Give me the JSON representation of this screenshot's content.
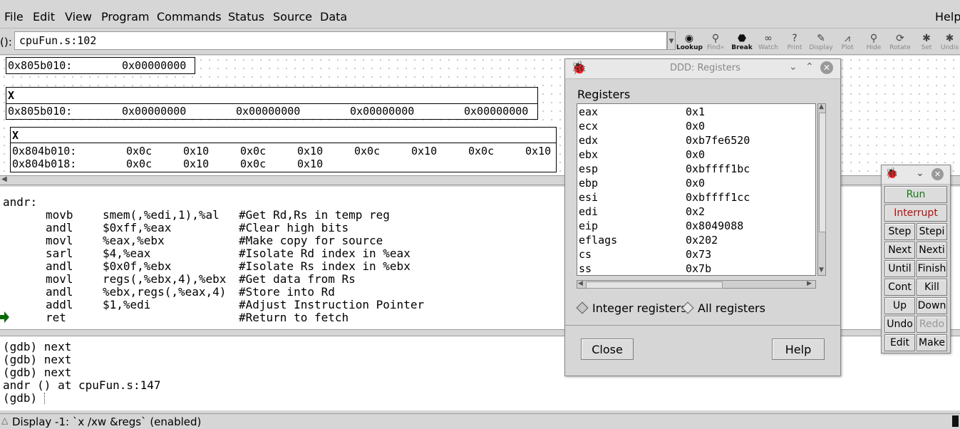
{
  "menu": {
    "items": [
      "File",
      "Edit",
      "View",
      "Program",
      "Commands",
      "Status",
      "Source",
      "Data"
    ],
    "help": "Help"
  },
  "argbar": {
    "label": "():",
    "value": "cpuFun.s:102"
  },
  "toolbar": [
    {
      "icon": "lookup-icon",
      "label": "Lookup",
      "enabled": true
    },
    {
      "icon": "find-icon",
      "label": "Find»",
      "enabled": false
    },
    {
      "icon": "break-icon",
      "label": "Break",
      "enabled": true
    },
    {
      "icon": "watch-icon",
      "label": "Watch",
      "enabled": false
    },
    {
      "icon": "print-icon",
      "label": "Print",
      "enabled": false
    },
    {
      "icon": "display-icon",
      "label": "Display",
      "enabled": false
    },
    {
      "icon": "plot-icon",
      "label": "Plot",
      "enabled": false
    },
    {
      "icon": "hide-icon",
      "label": "Hide",
      "enabled": false
    },
    {
      "icon": "rotate-icon",
      "label": "Rotate",
      "enabled": false
    },
    {
      "icon": "set-icon",
      "label": "Set",
      "enabled": false
    },
    {
      "icon": "undisp-icon",
      "label": "Undis",
      "enabled": false
    }
  ],
  "data_displays": {
    "d1": {
      "addr": "0x805b010:",
      "val": "0x00000000"
    },
    "d2": {
      "title": "X",
      "addr": "0x805b010:",
      "vals": [
        "0x00000000",
        "0x00000000",
        "0x00000000",
        "0x00000000"
      ]
    },
    "d3": {
      "title": "X",
      "rows": [
        {
          "addr": "0x804b010:",
          "vals": [
            "0x0c",
            "0x10",
            "0x0c",
            "0x10",
            "0x0c",
            "0x10",
            "0x0c",
            "0x10"
          ]
        },
        {
          "addr": "0x804b018:",
          "vals": [
            "0x0c",
            "0x10",
            "0x0c",
            "0x10"
          ]
        }
      ]
    }
  },
  "source": {
    "label": "andr:",
    "lines": [
      {
        "op": "movb",
        "args": "smem(,%edi,1),%al",
        "comment": "#Get Rd,Rs in temp reg"
      },
      {
        "op": "andl",
        "args": "$0xff,%eax",
        "comment": "#Clear high bits"
      },
      {
        "op": "movl",
        "args": "%eax,%ebx",
        "comment": "#Make copy for source"
      },
      {
        "op": "sarl",
        "args": "$4,%eax",
        "comment": "#Isolate Rd index in %eax"
      },
      {
        "op": "andl",
        "args": "$0x0f,%ebx",
        "comment": "#Isolate Rs index in %ebx"
      },
      {
        "op": "movl",
        "args": "regs(,%ebx,4),%ebx",
        "comment": "#Get data from Rs"
      },
      {
        "op": "andl",
        "args": "%ebx,regs(,%eax,4)",
        "comment": "#Store into Rd"
      },
      {
        "op": "addl",
        "args": "$1,%edi",
        "comment": "#Adjust Instruction Pointer"
      },
      {
        "op": "ret",
        "args": "",
        "comment": "#Return to fetch"
      }
    ]
  },
  "console": {
    "lines": [
      "(gdb) next",
      "(gdb) next",
      "(gdb) next",
      "andr () at cpuFun.s:147",
      "(gdb) "
    ]
  },
  "statusbar": {
    "text": "Display -1: `x /xw &regs` (enabled)"
  },
  "registers": {
    "title": "DDD: Registers",
    "heading": "Registers",
    "rows": [
      {
        "name": "eax",
        "value": "0x1"
      },
      {
        "name": "ecx",
        "value": "0x0"
      },
      {
        "name": "edx",
        "value": "0xb7fe6520"
      },
      {
        "name": "ebx",
        "value": "0x0"
      },
      {
        "name": "esp",
        "value": "0xbffff1bc"
      },
      {
        "name": "ebp",
        "value": "0x0"
      },
      {
        "name": "esi",
        "value": "0xbffff1cc"
      },
      {
        "name": "edi",
        "value": "0x2"
      },
      {
        "name": "eip",
        "value": "0x8049088"
      },
      {
        "name": "eflags",
        "value": "0x202"
      },
      {
        "name": "cs",
        "value": "0x73"
      },
      {
        "name": "ss",
        "value": "0x7b"
      }
    ],
    "radio_integer": "Integer registers",
    "radio_all": "All registers",
    "close": "Close",
    "help": "Help"
  },
  "commandtool": {
    "run": "Run",
    "interrupt": "Interrupt",
    "pairs": [
      [
        "Step",
        "Stepi"
      ],
      [
        "Next",
        "Nexti"
      ],
      [
        "Until",
        "Finish"
      ],
      [
        "Cont",
        "Kill"
      ],
      [
        "Up",
        "Down"
      ],
      [
        "Undo",
        "Redo"
      ],
      [
        "Edit",
        "Make"
      ]
    ],
    "colors": {
      "run": "#1a7a1a",
      "interrupt": "#b01010",
      "disabled": "#999999"
    }
  }
}
